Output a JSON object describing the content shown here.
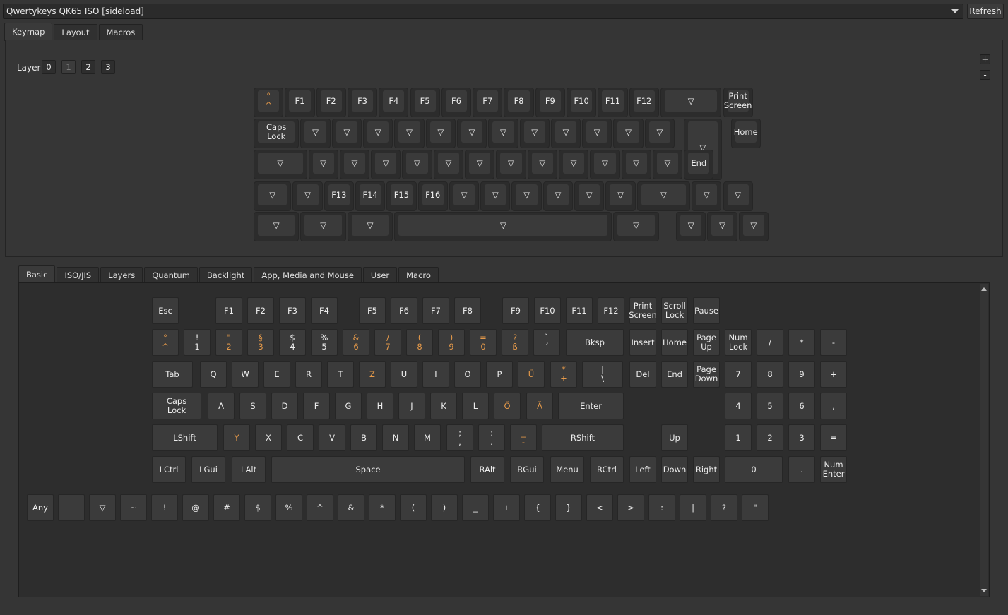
{
  "device": {
    "selected": "Qwertykeys QK65 ISO [sideload]",
    "refresh_label": "Refresh"
  },
  "top_tabs": [
    "Keymap",
    "Layout",
    "Macros"
  ],
  "layer": {
    "label": "Layer",
    "buttons": [
      "0",
      "1",
      "2",
      "3"
    ],
    "current": 1,
    "plus": "+",
    "minus": "-"
  },
  "keymap_rows": [
    [
      "°|^",
      "F1",
      "F2",
      "F3",
      "F4",
      "F5",
      "F6",
      "F7",
      "F8",
      "F9",
      "F10",
      "F11",
      "F12",
      "▽",
      "Print|Screen"
    ],
    [
      "Caps|Lock",
      "▽",
      "▽",
      "▽",
      "▽",
      "▽",
      "▽",
      "▽",
      "▽",
      "▽",
      "▽",
      "▽",
      "▽",
      "▽",
      "Home"
    ],
    [
      "▽",
      "▽",
      "▽",
      "▽",
      "▽",
      "▽",
      "▽",
      "▽",
      "▽",
      "▽",
      "▽",
      "▽",
      "▽",
      "End"
    ],
    [
      "▽",
      "▽",
      "F13",
      "F14",
      "F15",
      "F16",
      "▽",
      "▽",
      "▽",
      "▽",
      "▽",
      "▽",
      "▽",
      "▽",
      "▽"
    ],
    [
      "▽",
      "▽",
      "▽",
      "▽",
      "▽",
      "▽",
      "▽",
      "▽"
    ]
  ],
  "bottom_tabs": [
    "Basic",
    "ISO/JIS",
    "Layers",
    "Quantum",
    "Backlight",
    "App, Media and Mouse",
    "User",
    "Macro"
  ],
  "basic_rows": [
    [
      "Esc",
      "F1",
      "F2",
      "F3",
      "F4",
      "F5",
      "F6",
      "F7",
      "F8",
      "F9",
      "F10",
      "F11",
      "F12",
      "Print|Screen",
      "Scroll|Lock",
      "Pause"
    ],
    [
      "°|^",
      "!|1",
      "\"|2",
      "§|3",
      "$|4",
      "%|5",
      "&|6",
      "/|7",
      "(|8",
      ")|9",
      "=|0",
      "?|ß",
      "`|´",
      "Bksp",
      "Insert",
      "Home",
      "Page|Up",
      "Num|Lock",
      "/",
      "*",
      "-"
    ],
    [
      "Tab",
      "Q",
      "W",
      "E",
      "R",
      "T",
      "Z",
      "U",
      "I",
      "O",
      "P",
      "Ü",
      "*|+",
      "||\\",
      "Del",
      "End",
      "Page|Down",
      "7",
      "8",
      "9",
      "+"
    ],
    [
      "Caps|Lock",
      "A",
      "S",
      "D",
      "F",
      "G",
      "H",
      "J",
      "K",
      "L",
      "Ö",
      "Ä",
      "Enter",
      "4",
      "5",
      "6",
      ","
    ],
    [
      "LShift",
      "Y",
      "X",
      "C",
      "V",
      "B",
      "N",
      "M",
      ";|,",
      ":|.",
      "_|-",
      "RShift",
      "Up",
      "1",
      "2",
      "3",
      "="
    ],
    [
      "LCtrl",
      "LGui",
      "LAlt",
      "Space",
      "RAlt",
      "RGui",
      "Menu",
      "RCtrl",
      "Left",
      "Down",
      "Right",
      "0",
      ".",
      "Num|Enter"
    ],
    [
      "Any",
      "",
      "▽",
      "~",
      "!",
      "@",
      "#",
      "$",
      "%",
      "^",
      "&",
      "*",
      "(",
      ")",
      "_",
      "+",
      "{",
      "}",
      "<",
      ">",
      ":",
      "|",
      "?",
      "\""
    ]
  ],
  "colors": {
    "accent": "#e69a4a",
    "background": "#353535",
    "key": "#3a3a3a"
  }
}
